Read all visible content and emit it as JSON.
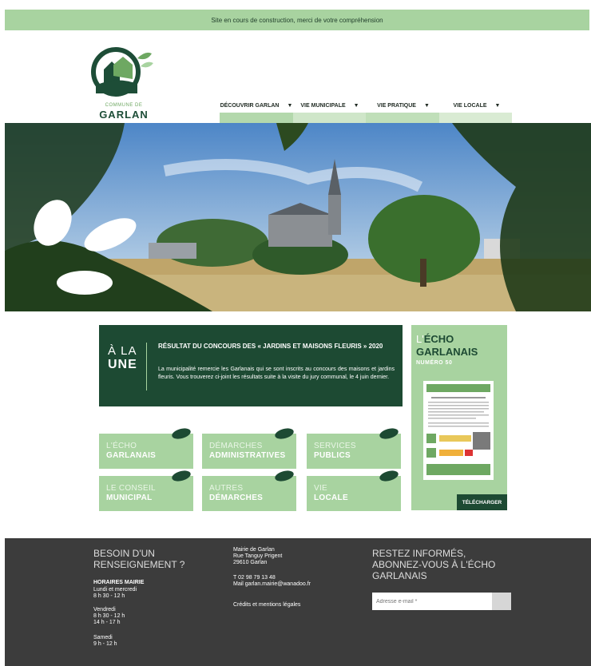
{
  "banner": {
    "text": "Site en cours de construction, merci de votre compréhension"
  },
  "logo": {
    "small_text": "COMMUNE DE",
    "name": "GARLAN"
  },
  "nav": {
    "items": [
      {
        "label": "DÉCOUVRIR GARLAN"
      },
      {
        "label": "VIE MUNICIPALE"
      },
      {
        "label": "VIE PRATIQUE"
      },
      {
        "label": "VIE LOCALE"
      }
    ]
  },
  "une": {
    "label_a": "À LA",
    "label_b": "UNE",
    "title": "RÉSULTAT DU CONCOURS DES « JARDINS ET MAISONS FLEURIS » 2020",
    "text": "La municipalité remercie les Garlanais qui se sont inscrits au concours des maisons et jardins fleuris. Vous trouverez ci-joint les résultats suite à la visite du jury communal, le 4 juin dernier."
  },
  "echo": {
    "prefix": "L'",
    "title": "ÉCHO GARLANAIS",
    "number": "NUMÉRO 50",
    "download": "TÉLÉCHARGER"
  },
  "tiles": [
    {
      "l1": "L'ÉCHO",
      "l2": "GARLANAIS"
    },
    {
      "l1": "DÉMARCHES",
      "l2": "ADMINISTRATIVES"
    },
    {
      "l1": "SERVICES",
      "l2": "PUBLICS"
    },
    {
      "l1": "LE CONSEIL",
      "l2": "MUNICIPAL"
    },
    {
      "l1": "AUTRES",
      "l2": "DÉMARCHES"
    },
    {
      "l1": "VIE",
      "l2": "LOCALE"
    }
  ],
  "footer": {
    "need_info": "BESOIN D'UN RENSEIGNEMENT ?",
    "hours_title": "HORAIRES MAIRIE",
    "hours": [
      "Lundi et mercredi",
      "8 h 30 - 12 h",
      "Vendredi",
      "8 h 30 - 12 h",
      "14 h - 17 h",
      "Samedi",
      "9 h - 12 h"
    ],
    "address": [
      "Mairie de Garlan",
      "Rue Tanguy Prigent",
      "29610 Garlan"
    ],
    "phone": "T 02 98 79 13 48",
    "mail": "Mail garlan.mairie@wanadoo.fr",
    "credits": "Crédits et mentions légales",
    "newsletter": "RESTEZ INFORMÉS, ABONNEZ-VOUS À L'ÉCHO GARLANAIS",
    "email_placeholder": "Adresse e-mail *"
  },
  "colors": {
    "dark_green": "#1d4a33",
    "light_green": "#a8d3a0",
    "footer": "#3c3c3c"
  }
}
